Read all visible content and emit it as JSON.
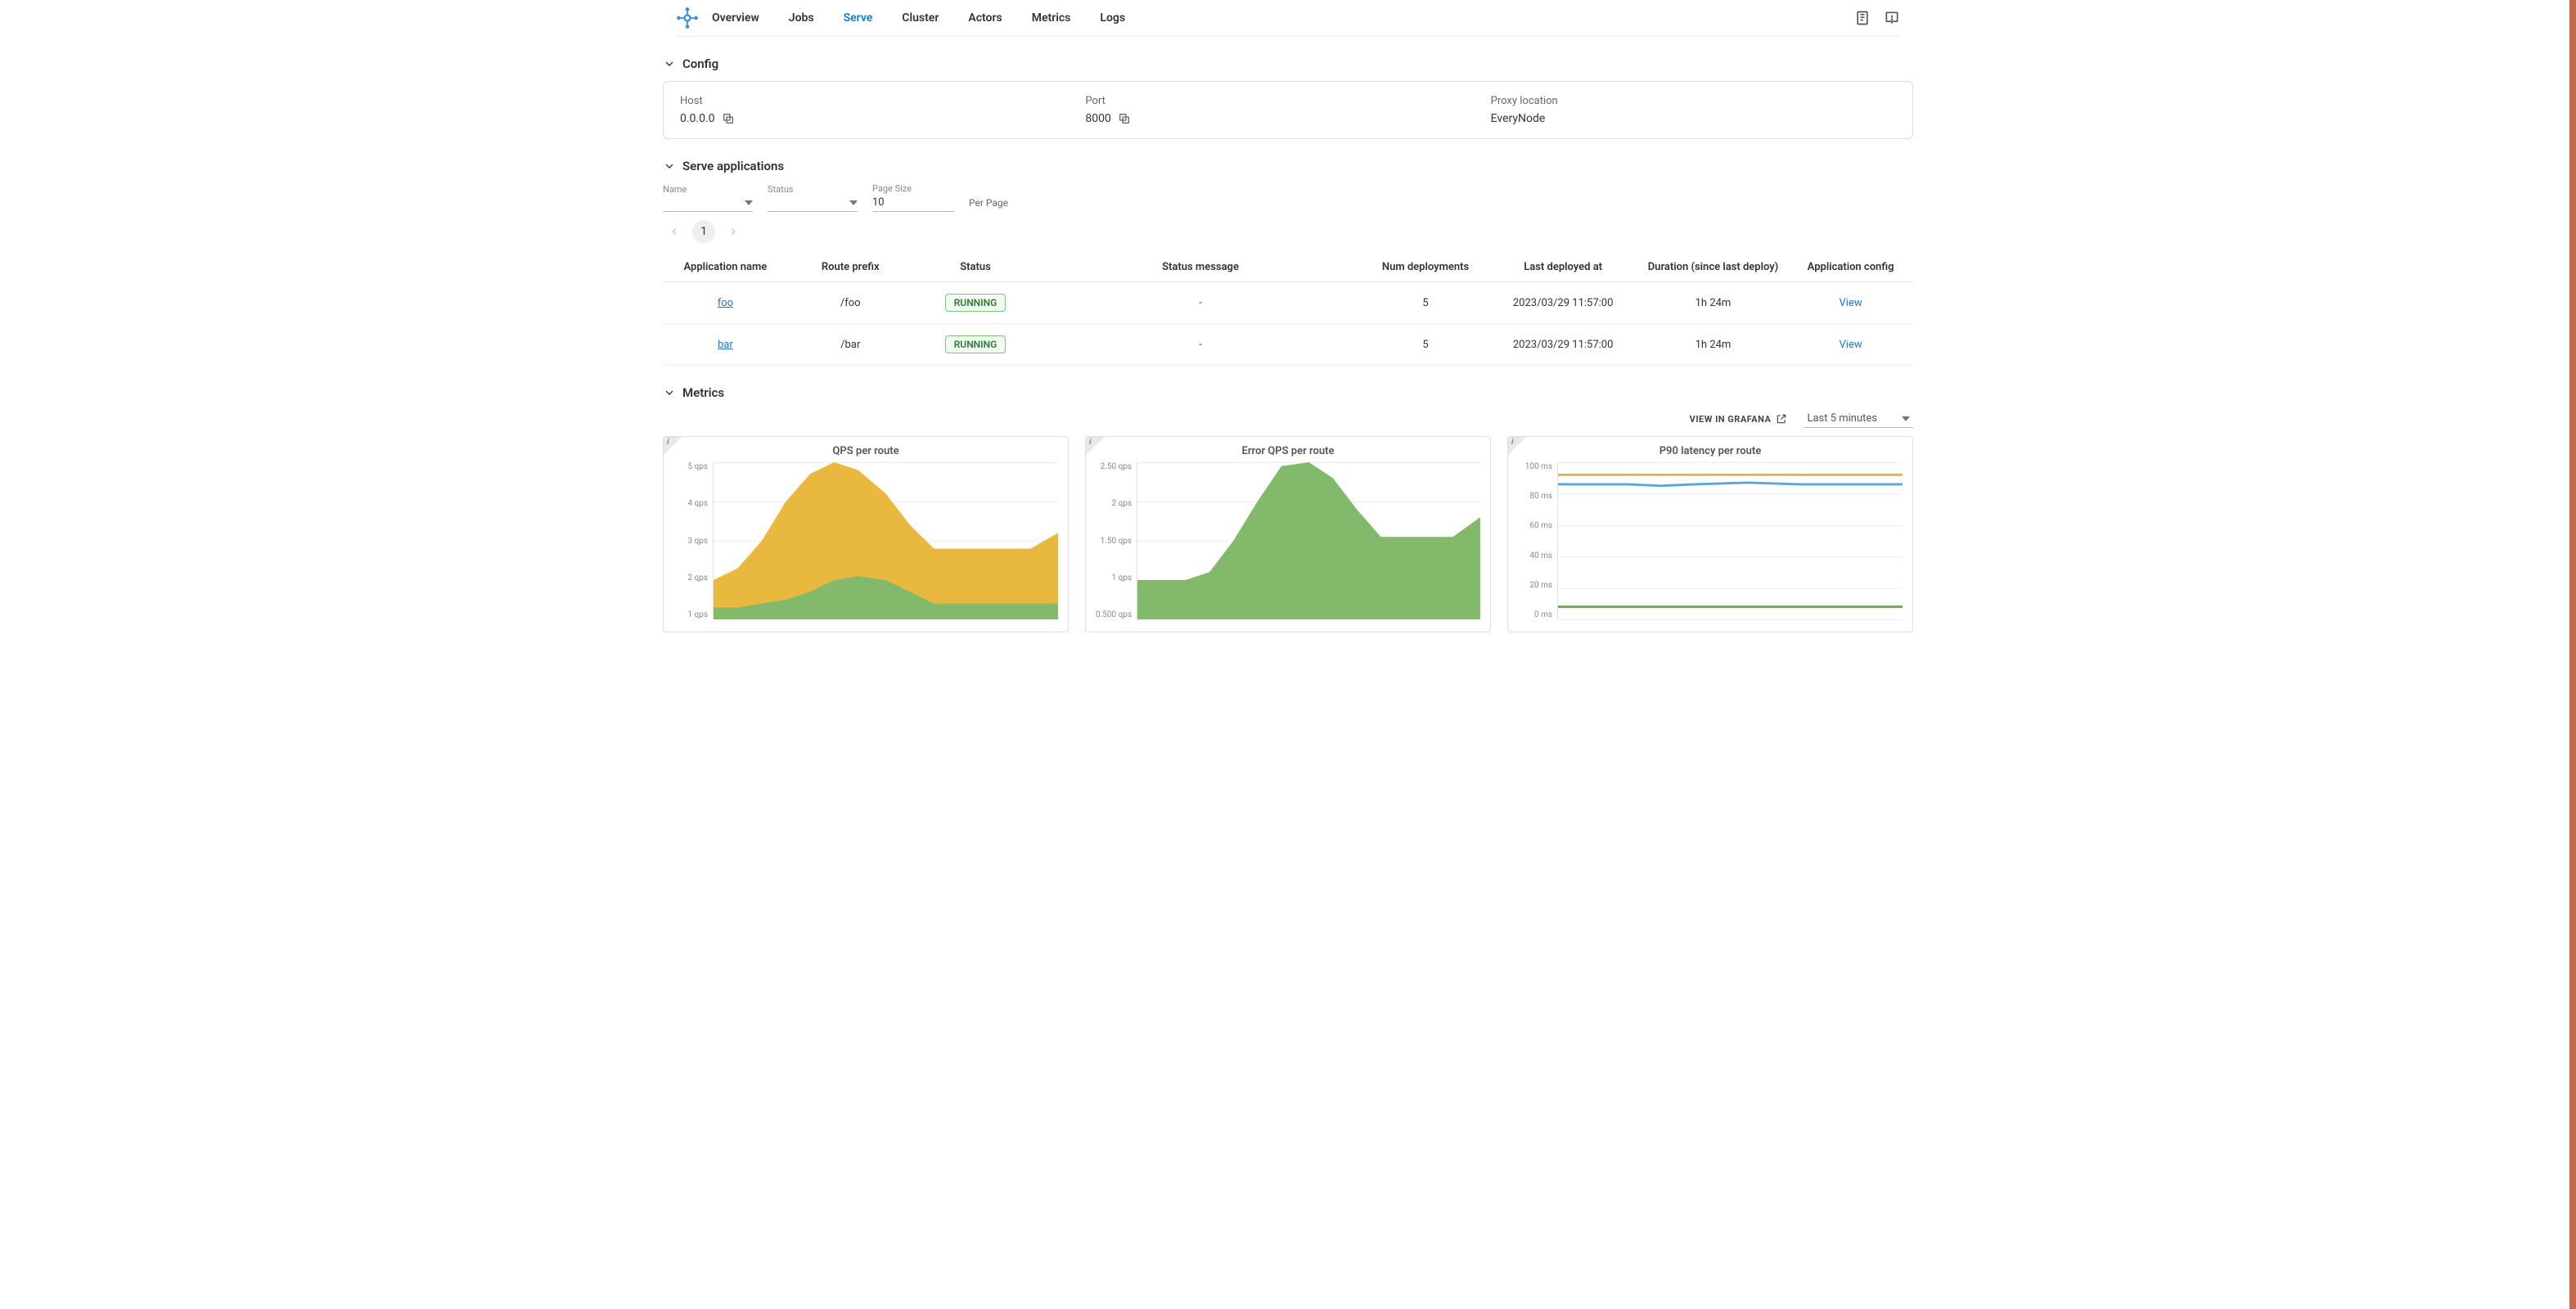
{
  "nav": {
    "tabs": [
      "Overview",
      "Jobs",
      "Serve",
      "Cluster",
      "Actors",
      "Metrics",
      "Logs"
    ],
    "active": "Serve"
  },
  "sections": {
    "config_title": "Config",
    "apps_title": "Serve applications",
    "metrics_title": "Metrics"
  },
  "config": {
    "host_label": "Host",
    "host_value": "0.0.0.0",
    "port_label": "Port",
    "port_value": "8000",
    "proxy_label": "Proxy location",
    "proxy_value": "EveryNode"
  },
  "filters": {
    "name_label": "Name",
    "name_value": "",
    "status_label": "Status",
    "status_value": "",
    "pagesize_label": "Page Size",
    "pagesize_value": "10",
    "perpage_label": "Per Page"
  },
  "pager": {
    "current": "1"
  },
  "table": {
    "columns": {
      "app_name": "Application name",
      "route_prefix": "Route prefix",
      "status": "Status",
      "status_message": "Status message",
      "num_deployments": "Num deployments",
      "last_deployed": "Last deployed at",
      "duration": "Duration (since last deploy)",
      "config": "Application config"
    },
    "rows": [
      {
        "name": "foo",
        "route": "/foo",
        "status": "RUNNING",
        "message": "-",
        "num": "5",
        "deployed": "2023/03/29 11:57:00",
        "duration": "1h 24m",
        "view": "View"
      },
      {
        "name": "bar",
        "route": "/bar",
        "status": "RUNNING",
        "message": "-",
        "num": "5",
        "deployed": "2023/03/29 11:57:00",
        "duration": "1h 24m",
        "view": "View"
      }
    ]
  },
  "metrics": {
    "grafana_label": "VIEW IN GRAFANA",
    "time_range": "Last 5 minutes",
    "panels": {
      "qps_title": "QPS per route",
      "error_qps_title": "Error QPS per route",
      "p90_title": "P90 latency per route"
    },
    "qps_yticks": [
      "5 qps",
      "4 qps",
      "3 qps",
      "2 qps",
      "1 qps"
    ],
    "error_yticks": [
      "2.50 qps",
      "2 qps",
      "1.50 qps",
      "1 qps",
      "0.500 qps"
    ],
    "p90_yticks": [
      "100 ms",
      "80 ms",
      "60 ms",
      "40 ms",
      "20 ms",
      "0 ms"
    ]
  },
  "chart_data": [
    {
      "type": "area",
      "title": "QPS per route",
      "ylabel": "qps",
      "ylim": [
        1,
        5
      ],
      "stacked": true,
      "x": [
        0,
        1,
        2,
        3,
        4,
        5,
        6,
        7,
        8,
        9,
        10,
        11,
        12,
        13,
        14
      ],
      "series": [
        {
          "name": "yellow (top stack)",
          "color": "#e8b93e",
          "values": [
            2.0,
            2.3,
            3.0,
            4.0,
            4.7,
            5.0,
            4.8,
            4.2,
            3.4,
            2.8,
            2.8,
            2.8,
            2.8,
            2.8,
            3.2
          ]
        },
        {
          "name": "green (bottom stack)",
          "color": "#82b96b",
          "values": [
            1.3,
            1.3,
            1.4,
            1.5,
            1.7,
            2.0,
            2.1,
            2.0,
            1.7,
            1.4,
            1.4,
            1.4,
            1.4,
            1.4,
            1.4
          ]
        }
      ]
    },
    {
      "type": "area",
      "title": "Error QPS per route",
      "ylabel": "qps",
      "ylim": [
        0.5,
        2.5
      ],
      "x": [
        0,
        1,
        2,
        3,
        4,
        5,
        6,
        7,
        8,
        9,
        10,
        11,
        12,
        13,
        14
      ],
      "series": [
        {
          "name": "green",
          "color": "#82b96b",
          "values": [
            1.0,
            1.0,
            1.0,
            1.1,
            1.5,
            2.0,
            2.45,
            2.5,
            2.3,
            1.9,
            1.55,
            1.55,
            1.55,
            1.55,
            1.8
          ]
        }
      ]
    },
    {
      "type": "line",
      "title": "P90 latency per route",
      "ylabel": "ms",
      "ylim": [
        0,
        100
      ],
      "x": [
        0,
        1,
        2,
        3,
        4,
        5,
        6,
        7,
        8,
        9,
        10,
        11,
        12,
        13,
        14
      ],
      "series": [
        {
          "name": "orange",
          "color": "#e9b04b",
          "values": [
            92,
            92,
            92,
            92,
            92,
            92,
            92,
            92,
            92,
            92,
            92,
            92,
            92,
            92,
            92
          ]
        },
        {
          "name": "blue",
          "color": "#5aa6d8",
          "values": [
            86,
            86,
            86,
            86,
            86,
            85,
            86,
            86,
            87,
            86,
            86,
            86,
            86,
            86,
            86
          ]
        },
        {
          "name": "green",
          "color": "#6fa356",
          "values": [
            8,
            8,
            8,
            8,
            8,
            8,
            8,
            8,
            8,
            8,
            8,
            8,
            8,
            8,
            8
          ]
        }
      ]
    }
  ]
}
